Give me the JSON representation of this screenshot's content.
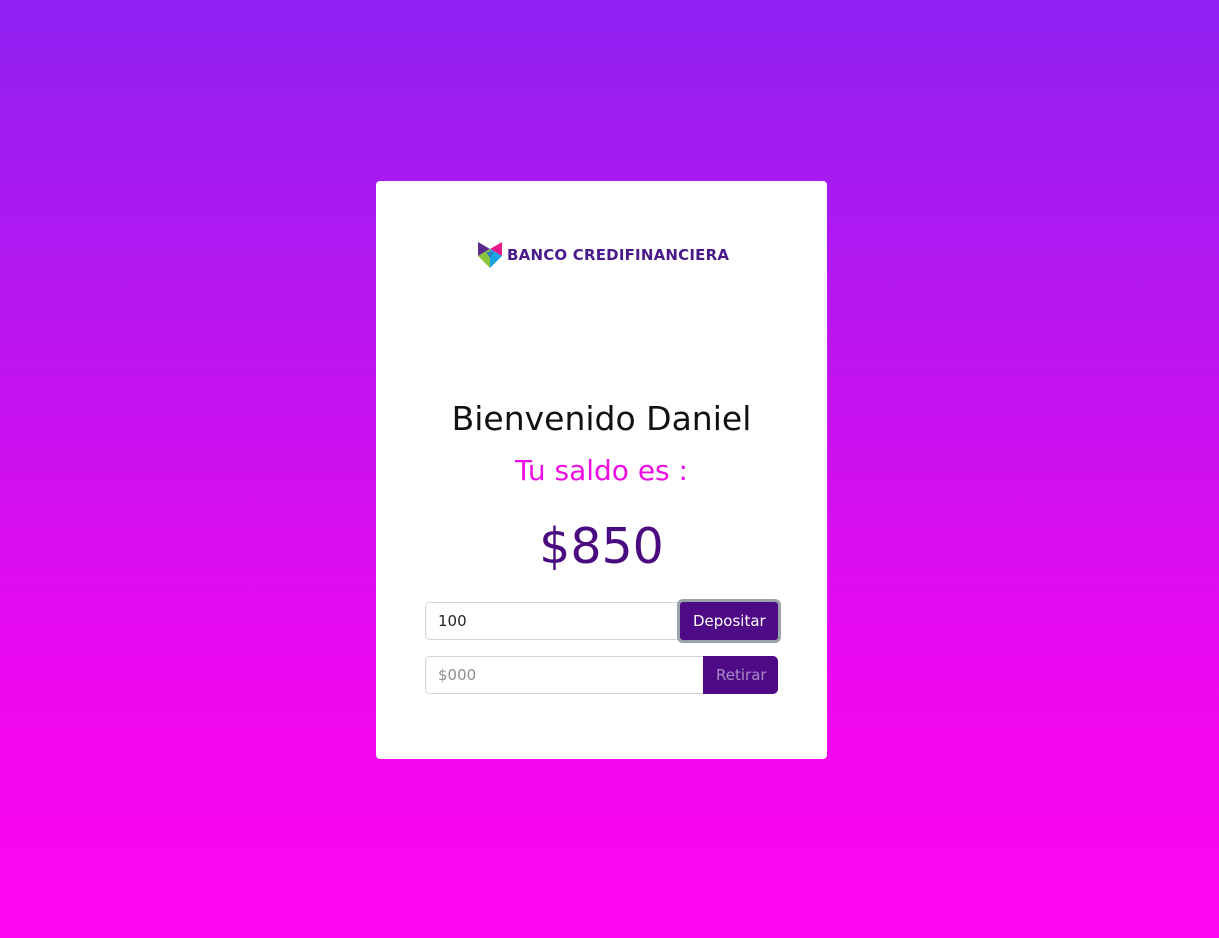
{
  "brand": {
    "name": "BANCO CREDIFINANCIERA",
    "colors": {
      "mark_magenta": "#e81a8b",
      "mark_purple": "#5b2c8e",
      "mark_blue": "#1aa3e0",
      "mark_green": "#8bc53f",
      "text": "#4b1a8a"
    }
  },
  "account": {
    "welcome": "Bienvenido Daniel",
    "balance_label": "Tu saldo es :",
    "balance_value": "$850"
  },
  "deposit": {
    "value": "100",
    "placeholder": "$000",
    "button_label": "Depositar"
  },
  "withdraw": {
    "value": "",
    "placeholder": "$000",
    "button_label": "Retirar"
  },
  "colors": {
    "accent": "#4e0a86",
    "balance_label": "#ee0fe6",
    "background_top": "#8f21f2",
    "background_bottom": "#ff05f0"
  }
}
